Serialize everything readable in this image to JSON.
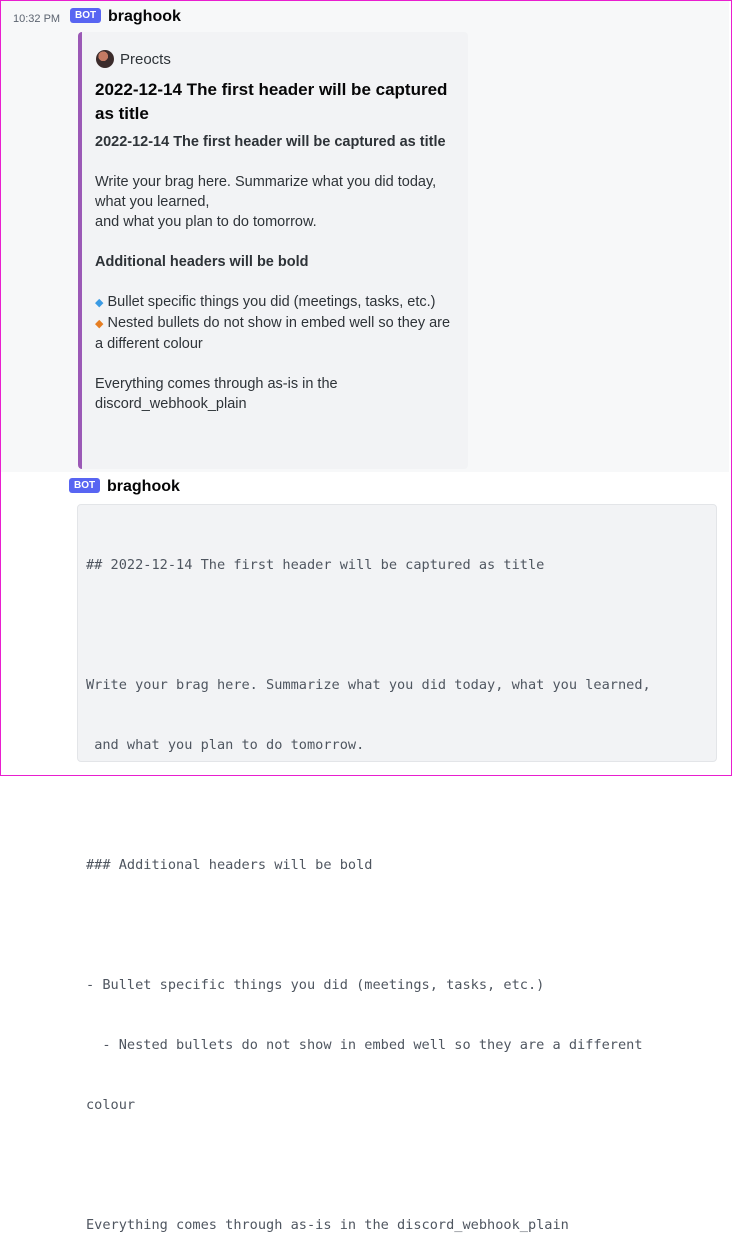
{
  "message1": {
    "timestamp": "10:32 PM",
    "bot_tag": "BOT",
    "username": "braghook",
    "embed": {
      "author": "Preocts",
      "author_icon": "avatar-icon",
      "accent_color": "#9b59b6",
      "title": "2022-12-14 The first header will be captured as title",
      "subheader": "2022-12-14 The first header will be captured as title",
      "intro_1": "Write your brag here. Summarize what you did today, what you learned,",
      "intro_2": "and what you plan to do tomorrow.",
      "header2": "Additional headers will be bold",
      "bullet1_icon": "◆",
      "bullet1": "Bullet specific things you did (meetings, tasks, etc.)",
      "bullet2_icon": "◆",
      "bullet2": "Nested bullets do not show in embed well so they are a different colour",
      "outro": "Everything comes through as-is in the discord_webhook_plain"
    }
  },
  "message2": {
    "bot_tag": "BOT",
    "username": "braghook",
    "code_lines": [
      "## 2022-12-14 The first header will be captured as title",
      "",
      "Write your brag here. Summarize what you did today, what you learned,",
      " and what you plan to do tomorrow.",
      "",
      "### Additional headers will be bold",
      "",
      "- Bullet specific things you did (meetings, tasks, etc.)",
      "  - Nested bullets do not show in embed well so they are a different",
      "colour",
      "",
      "Everything comes through as-is in the discord_webhook_plain"
    ]
  }
}
